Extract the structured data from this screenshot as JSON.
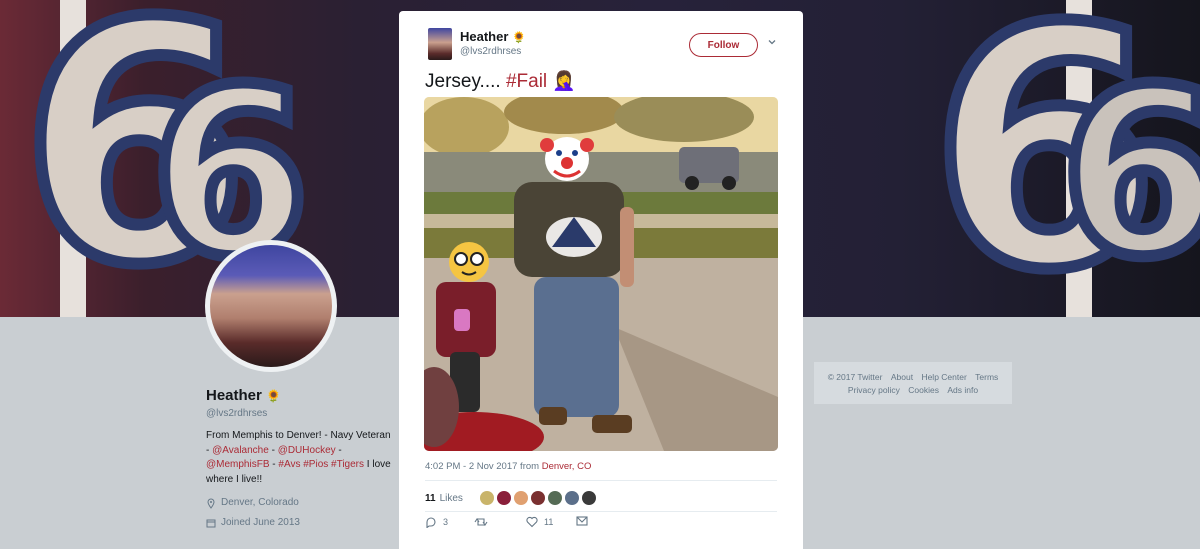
{
  "profile": {
    "name": "Heather",
    "handle": "@lvs2rdhrses",
    "bio_prefix": "From Memphis to Denver! - Navy Veteran -",
    "bio_link1": "@Avalanche",
    "bio_sep1": " - ",
    "bio_link2": "@DUHockey",
    "bio_sep2": " - ",
    "bio_link3": "@MemphisFB",
    "bio_sep3": " -",
    "bio_tag1": "#Avs",
    "bio_tag2": "#Pios",
    "bio_tag3": "#Tigers",
    "bio_suffix": " I love where I live!!",
    "location": "Denver, Colorado",
    "joined": "Joined June 2013"
  },
  "footer": {
    "links_row1": [
      "© 2017 Twitter",
      "About",
      "Help Center",
      "Terms"
    ],
    "links_row2": [
      "Privacy policy",
      "Cookies",
      "Ads info"
    ]
  },
  "tweet": {
    "author_name": "Heather",
    "author_handle": "@lvs2rdhrses",
    "follow_label": "Follow",
    "text_main": "Jersey.... ",
    "text_tag": "#Fail",
    "text_emoji": "🤦‍♀️",
    "time": "4:02 PM - 2 Nov 2017",
    "time_from": " from ",
    "location": "Denver, CO",
    "likes_count": "11",
    "likes_label": "Likes",
    "reply_count": "3",
    "like_count": "11"
  },
  "colors": {
    "accent": "#ab2b36",
    "secondary_text": "#657786"
  }
}
